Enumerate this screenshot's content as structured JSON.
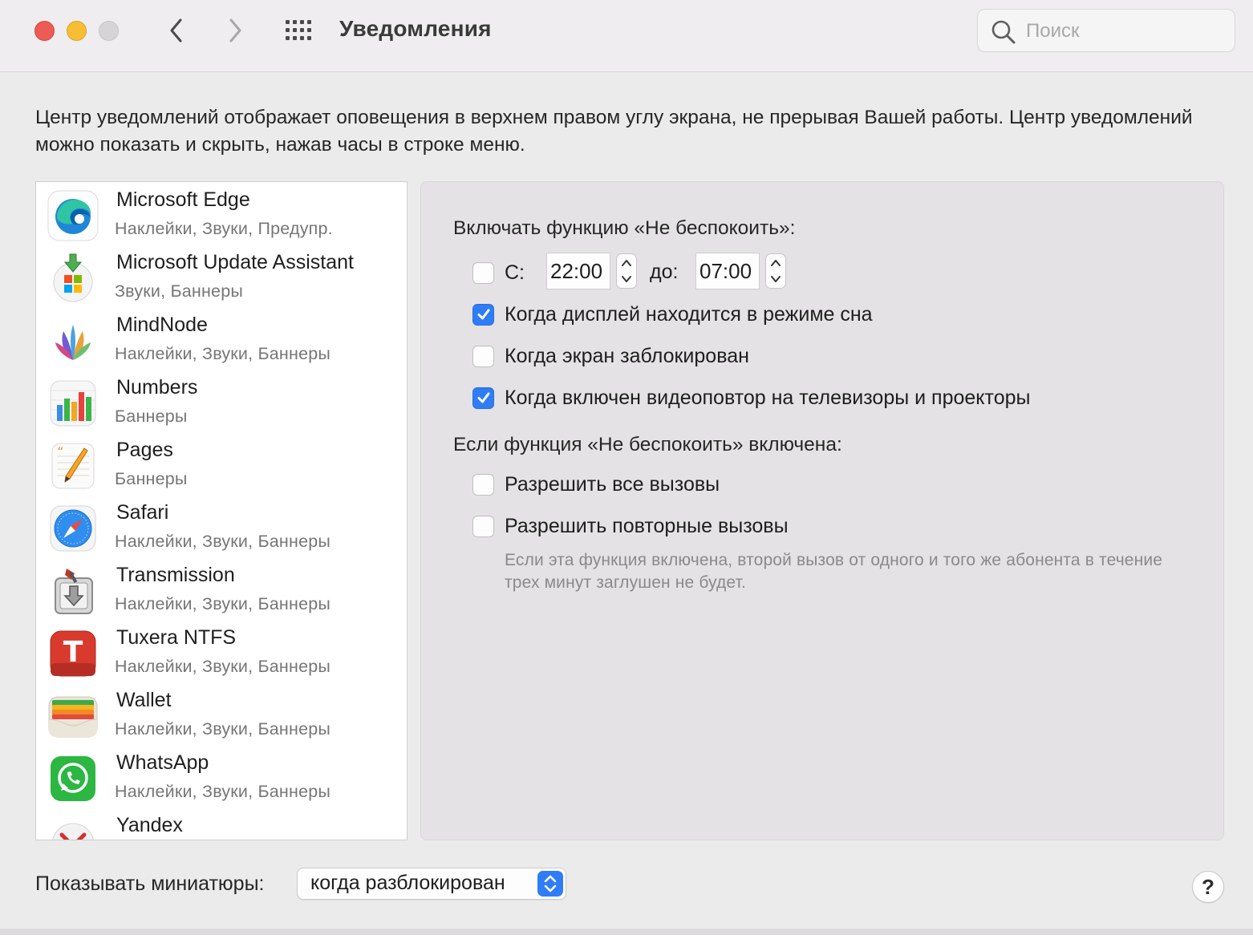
{
  "window": {
    "title": "Уведомления",
    "search_placeholder": "Поиск"
  },
  "description": "Центр уведомлений отображает оповещения в верхнем правом углу экрана, не прерывая Вашей работы. Центр уведомлений можно показать и скрыть, нажав часы в строке меню.",
  "apps": [
    {
      "name": "Microsoft Edge",
      "subtitle": "Наклейки, Звуки, Предупр.",
      "icon": "microsoft-edge-icon"
    },
    {
      "name": "Microsoft Update Assistant",
      "subtitle": "Звуки, Баннеры",
      "icon": "microsoft-update-assistant-icon"
    },
    {
      "name": "MindNode",
      "subtitle": "Наклейки, Звуки, Баннеры",
      "icon": "mindnode-icon"
    },
    {
      "name": "Numbers",
      "subtitle": "Баннеры",
      "icon": "numbers-icon"
    },
    {
      "name": "Pages",
      "subtitle": "Баннеры",
      "icon": "pages-icon"
    },
    {
      "name": "Safari",
      "subtitle": "Наклейки, Звуки, Баннеры",
      "icon": "safari-icon"
    },
    {
      "name": "Transmission",
      "subtitle": "Наклейки, Звуки, Баннеры",
      "icon": "transmission-icon"
    },
    {
      "name": "Tuxera NTFS",
      "subtitle": "Наклейки, Звуки, Баннеры",
      "icon": "tuxera-ntfs-icon"
    },
    {
      "name": "Wallet",
      "subtitle": "Наклейки, Звуки, Баннеры",
      "icon": "wallet-icon"
    },
    {
      "name": "WhatsApp",
      "subtitle": "Наклейки, Звуки, Баннеры",
      "icon": "whatsapp-icon"
    },
    {
      "name": "Yandex",
      "subtitle": "",
      "icon": "yandex-icon"
    }
  ],
  "dnd": {
    "heading": "Включать функцию «Не беспокоить»:",
    "schedule": {
      "checked": false,
      "from_label": "С:",
      "from_time": "22:00",
      "to_label": "до:",
      "to_time": "07:00"
    },
    "options": [
      {
        "label": "Когда дисплей находится в режиме сна",
        "checked": true
      },
      {
        "label": "Когда экран заблокирован",
        "checked": false
      },
      {
        "label": "Когда включен видеоповтор на телевизоры и проекторы",
        "checked": true
      }
    ],
    "when_on_heading": "Если функция «Не беспокоить» включена:",
    "call_options": [
      {
        "label": "Разрешить все вызовы",
        "checked": false
      },
      {
        "label": "Разрешить повторные вызовы",
        "checked": false
      }
    ],
    "hint": "Если эта функция включена, второй вызов от одного и того же абонента в течение трех минут заглушен не будет."
  },
  "footer": {
    "thumbnails_label": "Показывать миниатюры:",
    "thumbnails_value": "когда разблокирован",
    "help_label": "?"
  },
  "colors": {
    "accent": "#2f7df6",
    "close": "#ee5b54",
    "minimize": "#f6bf33"
  }
}
